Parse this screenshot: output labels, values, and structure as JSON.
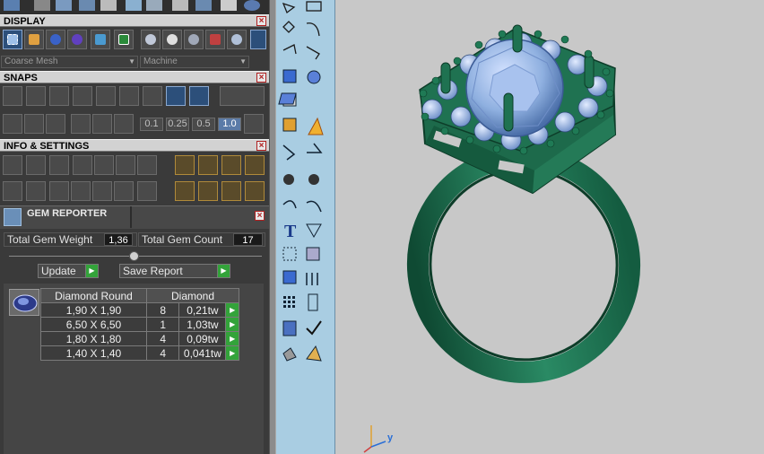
{
  "panels": {
    "display": {
      "title": "DISPLAY",
      "mesh_select": "Coarse Mesh",
      "material_select": "Machine"
    },
    "snaps": {
      "title": "SNAPS",
      "values": [
        "0.1",
        "0.25",
        "0.5",
        "1.0"
      ],
      "selected_value": "1.0"
    },
    "info_settings": {
      "title": "INFO & SETTINGS"
    },
    "gem_reporter": {
      "title": "GEM REPORTER",
      "total_weight_label": "Total Gem Weight",
      "total_weight_value": "1,36",
      "total_count_label": "Total Gem Count",
      "total_count_value": "17",
      "update_label": "Update",
      "save_label": "Save Report",
      "table": {
        "headers": [
          "Diamond Round",
          "Diamond"
        ],
        "rows": [
          {
            "size": "1,90 X 1,90",
            "count": "8",
            "weight": "0,21tw"
          },
          {
            "size": "6,50 X 6,50",
            "count": "1",
            "weight": "1,03tw"
          },
          {
            "size": "1,80 X 1,80",
            "count": "4",
            "weight": "0,09tw"
          },
          {
            "size": "1,40 X 1,40",
            "count": "4",
            "weight": "0,041tw"
          }
        ]
      }
    }
  },
  "viewport": {
    "axis_label": "y"
  },
  "colors": {
    "ring": "#1f6a4f",
    "gem": "#8fb0e0",
    "toolbar": "#a9cde2",
    "panel": "#3a3a3a"
  }
}
